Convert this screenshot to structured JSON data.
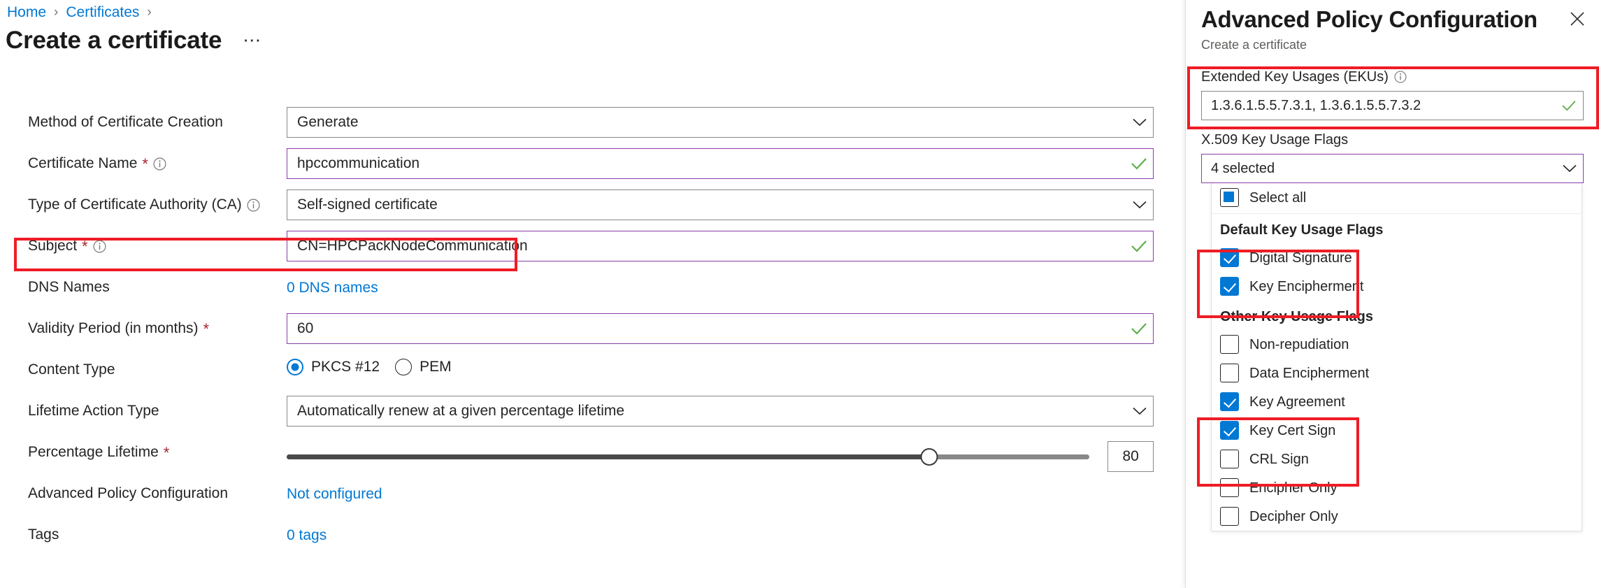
{
  "breadcrumb": {
    "home": "Home",
    "certificates": "Certificates",
    "separator": "›"
  },
  "page": {
    "title": "Create a certificate",
    "more_label": "⋯"
  },
  "form": {
    "rows": [
      {
        "label": "Method of Certificate Creation",
        "required": false,
        "info": false,
        "type": "select",
        "value": "Generate",
        "state": "normal"
      },
      {
        "label": "Certificate Name",
        "required": true,
        "info": true,
        "type": "text",
        "value": "hpccommunication",
        "state": "valid"
      },
      {
        "label": "Type of Certificate Authority (CA)",
        "required": false,
        "info": true,
        "type": "select",
        "value": "Self-signed certificate",
        "state": "normal"
      },
      {
        "label": "Subject",
        "required": true,
        "info": true,
        "type": "text",
        "value": "CN=HPCPackNodeCommunication",
        "state": "valid"
      },
      {
        "label": "DNS Names",
        "required": false,
        "info": false,
        "type": "link",
        "value": "0 DNS names",
        "state": "normal"
      },
      {
        "label": "Validity Period (in months)",
        "required": true,
        "info": false,
        "type": "text",
        "value": "60",
        "state": "valid"
      },
      {
        "label": "Content Type",
        "required": false,
        "info": false,
        "type": "radio",
        "value": "PKCS #12",
        "state": "normal"
      },
      {
        "label": "Lifetime Action Type",
        "required": false,
        "info": false,
        "type": "select",
        "value": "Automatically renew at a given percentage lifetime",
        "state": "normal"
      },
      {
        "label": "Percentage Lifetime",
        "required": true,
        "info": false,
        "type": "slider",
        "value": "80",
        "state": "normal"
      },
      {
        "label": "Advanced Policy Configuration",
        "required": false,
        "info": false,
        "type": "link",
        "value": "Not configured",
        "state": "normal"
      },
      {
        "label": "Tags",
        "required": false,
        "info": false,
        "type": "link",
        "value": "0 tags",
        "state": "normal"
      }
    ],
    "content_type_options": [
      {
        "label": "PKCS #12",
        "selected": true
      },
      {
        "label": "PEM",
        "selected": false
      }
    ],
    "slider": {
      "value": "80",
      "percent": 80,
      "min": 0,
      "max": 100
    }
  },
  "panel": {
    "title": "Advanced Policy Configuration",
    "subtitle": "Create a certificate",
    "close_icon": "close-icon",
    "eku": {
      "label": "Extended Key Usages (EKUs)",
      "value": "1.3.6.1.5.5.7.3.1, 1.3.6.1.5.5.7.3.2",
      "state": "valid"
    },
    "key_usage": {
      "label": "X.509 Key Usage Flags",
      "selected_text": "4 selected",
      "select_all_label": "Select all",
      "select_all_state": "partial",
      "groups": [
        {
          "title": "Default Key Usage Flags",
          "items": [
            {
              "label": "Digital Signature",
              "checked": true
            },
            {
              "label": "Key Encipherment",
              "checked": true
            }
          ]
        },
        {
          "title": "Other Key Usage Flags",
          "items": [
            {
              "label": "Non-repudiation",
              "checked": false
            },
            {
              "label": "Data Encipherment",
              "checked": false
            },
            {
              "label": "Key Agreement",
              "checked": true
            },
            {
              "label": "Key Cert Sign",
              "checked": true
            },
            {
              "label": "CRL Sign",
              "checked": false
            },
            {
              "label": "Encipher Only",
              "checked": false
            },
            {
              "label": "Decipher Only",
              "checked": false
            }
          ]
        }
      ]
    }
  },
  "annotations": {
    "color": "#ee1c25",
    "boxes": [
      {
        "name": "subject-row-highlight"
      },
      {
        "name": "eku-highlight"
      },
      {
        "name": "default-flags-highlight"
      },
      {
        "name": "other-flags-highlight"
      }
    ]
  },
  "colors": {
    "link": "#0078d4",
    "accent_checkbox": "#0078d4",
    "valid_border": "#8a3ea8",
    "valid_check": "#5aac44",
    "required_star": "#a4262c",
    "annotation": "#ee1c25"
  }
}
